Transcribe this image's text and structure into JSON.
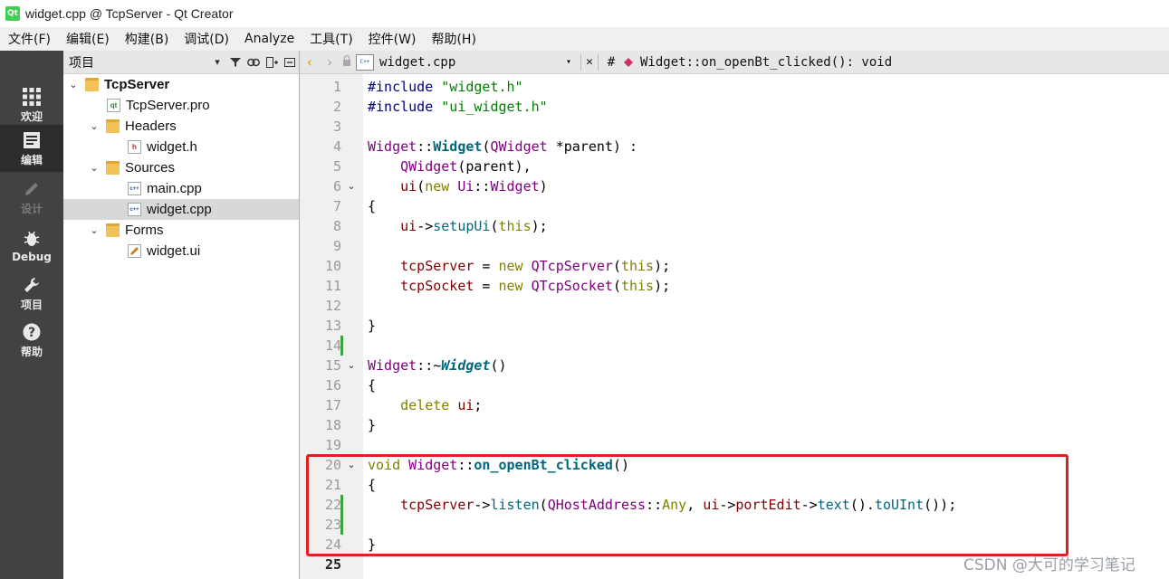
{
  "window": {
    "title": "widget.cpp @ TcpServer - Qt Creator",
    "logo": "Qt"
  },
  "menu": [
    "文件(F)",
    "编辑(E)",
    "构建(B)",
    "调试(D)",
    "Analyze",
    "工具(T)",
    "控件(W)",
    "帮助(H)"
  ],
  "modes": [
    {
      "label": "欢迎",
      "icon": "grid-icon",
      "state": "normal"
    },
    {
      "label": "编辑",
      "icon": "edit-document-icon",
      "state": "active"
    },
    {
      "label": "设计",
      "icon": "pencil-icon",
      "state": "disabled"
    },
    {
      "label": "Debug",
      "icon": "bug-icon",
      "state": "normal"
    },
    {
      "label": "项目",
      "icon": "wrench-icon",
      "state": "normal"
    },
    {
      "label": "帮助",
      "icon": "help-icon",
      "state": "normal"
    }
  ],
  "project_panel": {
    "title": "项目",
    "tree": [
      {
        "label": "TcpServer",
        "level": 0,
        "expanded": true,
        "icon": "folder",
        "badge": "qt",
        "bold": true
      },
      {
        "label": "TcpServer.pro",
        "level": 1,
        "icon": "file",
        "badge": "qt"
      },
      {
        "label": "Headers",
        "level": 1,
        "expanded": true,
        "icon": "folder",
        "badge": "h"
      },
      {
        "label": "widget.h",
        "level": 2,
        "icon": "file",
        "badge": "h"
      },
      {
        "label": "Sources",
        "level": 1,
        "expanded": true,
        "icon": "folder",
        "badge": "c++"
      },
      {
        "label": "main.cpp",
        "level": 2,
        "icon": "file",
        "badge": "c++"
      },
      {
        "label": "widget.cpp",
        "level": 2,
        "icon": "file",
        "badge": "c++",
        "selected": true
      },
      {
        "label": "Forms",
        "level": 1,
        "expanded": true,
        "icon": "folder",
        "badge": "ui"
      },
      {
        "label": "widget.ui",
        "level": 2,
        "icon": "file",
        "badge": "ui"
      }
    ]
  },
  "editor": {
    "file_tab": "widget.cpp",
    "file_badge": "C++",
    "hash_label": "#",
    "symbol": "Widget::on_openBt_clicked(): void",
    "current_line": 25,
    "lines": [
      {
        "n": "1",
        "tokens": [
          [
            "pre",
            "#include "
          ],
          [
            "str",
            "\"widget.h\""
          ]
        ]
      },
      {
        "n": "2",
        "tokens": [
          [
            "pre",
            "#include "
          ],
          [
            "str",
            "\"ui_widget.h\""
          ]
        ]
      },
      {
        "n": "3",
        "tokens": []
      },
      {
        "n": "4",
        "tokens": [
          [
            "cls",
            "Widget"
          ],
          [
            "",
            "::"
          ],
          [
            "fnb",
            "Widget"
          ],
          [
            "",
            "("
          ],
          [
            "cls",
            "QWidget"
          ],
          [
            "",
            " *parent) :"
          ]
        ]
      },
      {
        "n": "5",
        "tokens": [
          [
            "",
            "    "
          ],
          [
            "cls",
            "QWidget"
          ],
          [
            "",
            "(parent),"
          ]
        ]
      },
      {
        "n": "6",
        "fold": true,
        "tokens": [
          [
            "",
            "    "
          ],
          [
            "mem",
            "ui"
          ],
          [
            "",
            "("
          ],
          [
            "kw",
            "new"
          ],
          [
            " ",
            ""
          ],
          [
            "cls",
            " Ui"
          ],
          [
            "",
            "::"
          ],
          [
            "cls",
            "Widget"
          ],
          [
            "",
            ")"
          ]
        ]
      },
      {
        "n": "7",
        "tokens": [
          [
            "",
            "{"
          ]
        ]
      },
      {
        "n": "8",
        "tokens": [
          [
            "",
            "    "
          ],
          [
            "mem",
            "ui"
          ],
          [
            "",
            "->"
          ],
          [
            "fn",
            "setupUi"
          ],
          [
            "",
            "("
          ],
          [
            "kw",
            "this"
          ],
          [
            "",
            ");"
          ]
        ]
      },
      {
        "n": "9",
        "tokens": []
      },
      {
        "n": "10",
        "tokens": [
          [
            "",
            "    "
          ],
          [
            "mem",
            "tcpServer"
          ],
          [
            "",
            " = "
          ],
          [
            "kw",
            "new"
          ],
          [
            "cls",
            " QTcpServer"
          ],
          [
            "",
            "("
          ],
          [
            "kw",
            "this"
          ],
          [
            "",
            ");"
          ]
        ]
      },
      {
        "n": "11",
        "tokens": [
          [
            "",
            "    "
          ],
          [
            "mem",
            "tcpSocket"
          ],
          [
            "",
            " = "
          ],
          [
            "kw",
            "new"
          ],
          [
            "cls",
            " QTcpSocket"
          ],
          [
            "",
            "("
          ],
          [
            "kw",
            "this"
          ],
          [
            "",
            ");"
          ]
        ]
      },
      {
        "n": "12",
        "tokens": []
      },
      {
        "n": "13",
        "tokens": [
          [
            "",
            "}"
          ]
        ]
      },
      {
        "n": "14",
        "mark": true,
        "tokens": []
      },
      {
        "n": "15",
        "fold": true,
        "tokens": [
          [
            "cls",
            "Widget"
          ],
          [
            "",
            "::~"
          ],
          [
            "fni",
            "Widget"
          ],
          [
            "",
            "()"
          ]
        ]
      },
      {
        "n": "16",
        "tokens": [
          [
            "",
            "{"
          ]
        ]
      },
      {
        "n": "17",
        "tokens": [
          [
            "",
            "    "
          ],
          [
            "kw",
            "delete"
          ],
          [
            "mem",
            " ui"
          ],
          [
            "",
            ";"
          ]
        ]
      },
      {
        "n": "18",
        "tokens": [
          [
            "",
            "}"
          ]
        ]
      },
      {
        "n": "19",
        "tokens": []
      },
      {
        "n": "20",
        "fold": true,
        "tokens": [
          [
            "kw",
            "void"
          ],
          [
            "cls",
            " Widget"
          ],
          [
            "",
            "::"
          ],
          [
            "fnb",
            "on_openBt_clicked"
          ],
          [
            "",
            "()"
          ]
        ]
      },
      {
        "n": "21",
        "tokens": [
          [
            "",
            "{"
          ]
        ]
      },
      {
        "n": "22",
        "mark": true,
        "tokens": [
          [
            "",
            "    "
          ],
          [
            "mem",
            "tcpServer"
          ],
          [
            "",
            "->"
          ],
          [
            "fn",
            "listen"
          ],
          [
            "",
            "("
          ],
          [
            "cls",
            "QHostAddress"
          ],
          [
            "",
            "::"
          ],
          [
            "kw",
            "Any"
          ],
          [
            "",
            ", "
          ],
          [
            "mem",
            "ui"
          ],
          [
            "",
            "->"
          ],
          [
            "mem",
            "portEdit"
          ],
          [
            "",
            "->"
          ],
          [
            "fn",
            "text"
          ],
          [
            "",
            "()."
          ],
          [
            "fn",
            "toUInt"
          ],
          [
            "",
            "());"
          ]
        ]
      },
      {
        "n": "23",
        "mark": true,
        "tokens": []
      },
      {
        "n": "24",
        "tokens": [
          [
            "",
            "}"
          ]
        ]
      },
      {
        "n": "25",
        "tokens": []
      }
    ]
  },
  "watermark": "CSDN @大可的学习笔记",
  "colors": {
    "accent_highlight": "#e02020",
    "sidebar": "#404244",
    "change_mark": "#3aa33a"
  }
}
